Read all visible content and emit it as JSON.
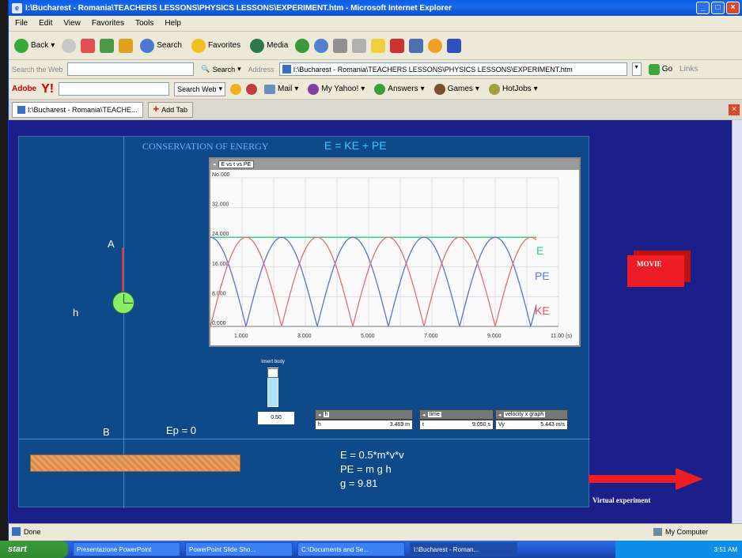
{
  "window": {
    "title": "I:\\Bucharest - Romania\\TEACHERS LESSONS\\PHYSICS LESSONS\\EXPERIMENT.htm - Microsoft Internet Explorer"
  },
  "menu": [
    "File",
    "Edit",
    "View",
    "Favorites",
    "Tools",
    "Help"
  ],
  "toolbar": {
    "back": "Back",
    "search": "Search",
    "favorites": "Favorites",
    "media": "Media"
  },
  "addressbar": {
    "search_placeholder": "Search the Web",
    "search_button": "Search",
    "address_label": "Address",
    "address_value": "I:\\Bucharest - Romania\\TEACHERS LESSONS\\PHYSICS LESSONS\\EXPERIMENT.htm",
    "go": "Go",
    "links": "Links"
  },
  "linksbar": {
    "adobe": "Adobe",
    "yahoo": "Y!",
    "search_web": "Search Web",
    "mail": "Mail",
    "my_yahoo": "My Yahoo!",
    "answers": "Answers",
    "games": "Games",
    "hotjobs": "HotJobs"
  },
  "tabs": {
    "active": "I:\\Bucharest - Romania\\TEACHE...",
    "add": "Add Tab"
  },
  "sim": {
    "title": "CONSERVATION OF ENERGY",
    "equation": "E = KE + PE",
    "label_a": "A",
    "label_h": "h",
    "label_b": "B",
    "ep": "Ep = 0",
    "slider_label": "Insert body",
    "slider_value": "0.50",
    "formula1": "E = 0.5*m*v*v",
    "formula2": "PE = m g h",
    "formula3": "g = 9.81",
    "movie": "MOVIE",
    "virtual": "Virtual experiment"
  },
  "readouts": [
    {
      "name": "h",
      "value": "3.469 m"
    },
    {
      "name": "time",
      "value": "9.050 s"
    },
    {
      "name": "velocity x graph",
      "value": "5.443 m/s",
      "prefix": "Vy"
    }
  ],
  "chart_data": {
    "type": "line",
    "header": "E vs t vs PE",
    "x_ticks": [
      "1.000",
      "3.000",
      "5.000",
      "7.000",
      "9.000",
      "11.00 (s)"
    ],
    "y_ticks": [
      "0.000",
      "8.000",
      "16.000",
      "24.000",
      "32.000",
      "No.000"
    ],
    "xlim": [
      0,
      11
    ],
    "ylim": [
      0,
      40
    ],
    "series": [
      {
        "name": "E",
        "color": "#2fd06a",
        "shape": "constant",
        "level": 24
      },
      {
        "name": "PE",
        "color": "#5a6ee0",
        "shape": "abs-cos",
        "amplitude": 24
      },
      {
        "name": "KE",
        "color": "#e07070",
        "shape": "abs-sin",
        "amplitude": 24
      }
    ],
    "period": 2.25
  },
  "status": {
    "left": "Done",
    "right": "My Computer"
  },
  "taskbar": {
    "start": "start",
    "items": [
      "Presentazione PowerPoint",
      "PowerPoint Slide Sho...",
      "C:\\Documents and Se...",
      "I:\\Bucharest - Roman..."
    ],
    "clock": "3:51 AM"
  },
  "colors": {
    "page_bg": "#1a1f8a",
    "sim_bg": "#0e4a8a",
    "accent_red": "#ee1c24"
  }
}
